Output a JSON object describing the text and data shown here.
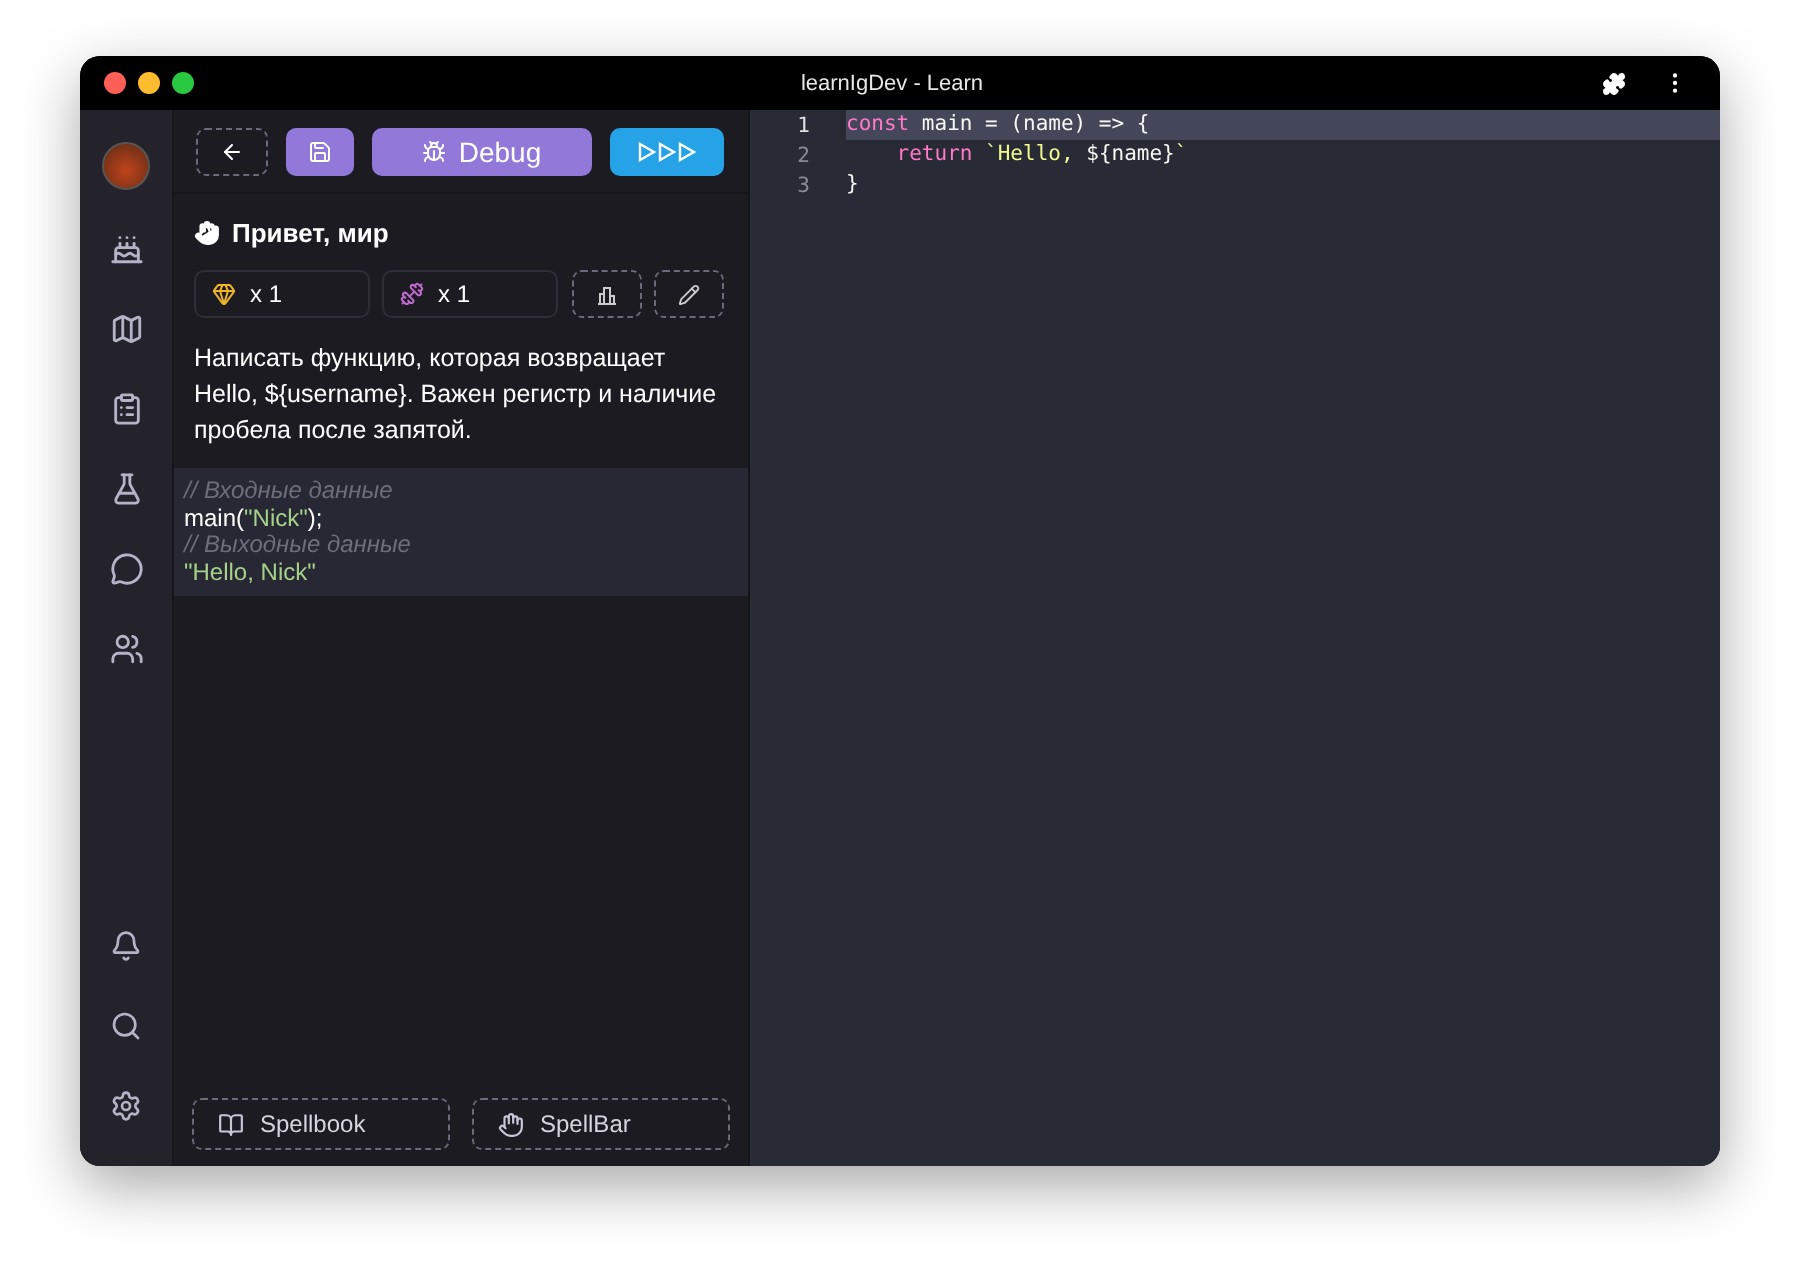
{
  "window": {
    "title": "learnIgDev - Learn"
  },
  "toolbar": {
    "debug_label": "Debug"
  },
  "task": {
    "title": "Привет, мир",
    "stats": [
      {
        "kind": "gem",
        "count": "x 1"
      },
      {
        "kind": "dumbbell",
        "count": "x 1"
      }
    ],
    "description": "Написать функцию, которая возвращает Hello, ${username}. Важен регистр и наличие пробела после запятой.",
    "example": [
      [
        {
          "text": "// Входные данные",
          "kind": "comment"
        }
      ],
      [
        {
          "text": "main(",
          "kind": "plain"
        },
        {
          "text": "\"Nick\"",
          "kind": "string"
        },
        {
          "text": ");",
          "kind": "plain"
        }
      ],
      [
        {
          "text": "// Выходные данные",
          "kind": "comment"
        }
      ],
      [
        {
          "text": "\"Hello, Nick\"",
          "kind": "string"
        }
      ]
    ]
  },
  "bottom_buttons": [
    {
      "kind": "book",
      "label": "Spellbook"
    },
    {
      "kind": "hand",
      "label": "SpellBar"
    }
  ],
  "editor": {
    "lines": [
      {
        "number": "1",
        "active": true,
        "tokens": [
          {
            "text": "const",
            "kind": "keyword"
          },
          {
            "text": " main = (name) => {",
            "kind": "plain"
          }
        ]
      },
      {
        "number": "2",
        "active": false,
        "tokens": [
          {
            "text": "    return",
            "kind": "keyword"
          },
          {
            "text": " `Hello, ",
            "kind": "string"
          },
          {
            "text": "${name}",
            "kind": "plain"
          },
          {
            "text": "`",
            "kind": "string"
          }
        ]
      },
      {
        "number": "3",
        "active": false,
        "tokens": [
          {
            "text": "}",
            "kind": "plain"
          }
        ]
      }
    ]
  }
}
